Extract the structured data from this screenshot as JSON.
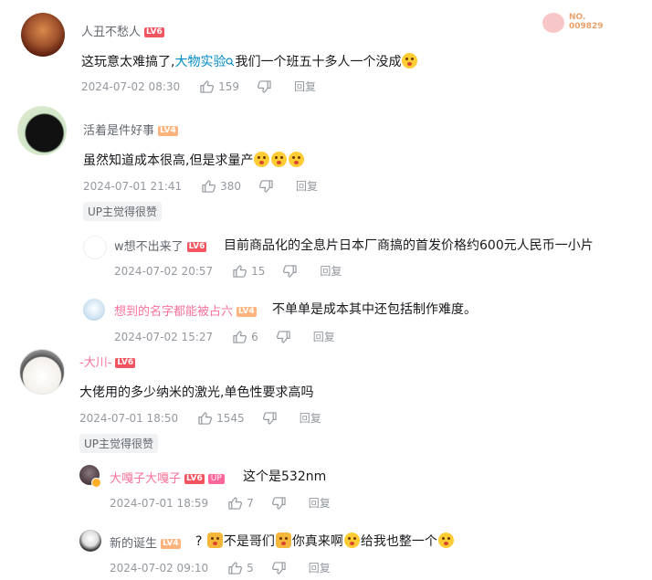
{
  "comments": [
    {
      "user": "人丑不愁人",
      "level": "LV6",
      "content_pre": "这玩意太难搞了,",
      "keyword": "大物实验",
      "content_post": "我们一个班五十多人一个没成",
      "time": "2024-07-02 08:30",
      "likes": "159",
      "reply_label": "回复",
      "badge": "NO.\n009829"
    },
    {
      "user": "活着是件好事",
      "level": "LV4",
      "content": "虽然知道成本很高,但是求量产",
      "time": "2024-07-01 21:41",
      "likes": "380",
      "reply_label": "回复",
      "up_tag": "UP主觉得很赞",
      "replies": [
        {
          "user": "w想不出来了",
          "level": "LV6",
          "content": "目前商品化的全息片日本厂商搞的首发价格约600元人民币一小片",
          "time": "2024-07-02 20:57",
          "likes": "15",
          "reply_label": "回复"
        },
        {
          "user": "想到的名字都能被占六",
          "level": "LV4",
          "content": "不单单是成本其中还包括制作难度。",
          "time": "2024-07-02 15:27",
          "likes": "6",
          "reply_label": "回复"
        }
      ]
    },
    {
      "user": "-大川-",
      "level": "LV6",
      "content": "大佬用的多少纳米的激光,单色性要求高吗",
      "time": "2024-07-01 18:50",
      "likes": "1545",
      "reply_label": "回复",
      "up_tag": "UP主觉得很赞",
      "replies": [
        {
          "user": "大嘎子大嘎子",
          "level": "LV6",
          "up_badge": "UP",
          "content": "这个是532nm",
          "time": "2024-07-01 18:59",
          "likes": "7",
          "reply_label": "回复"
        },
        {
          "user": "新的诞生",
          "level": "LV4",
          "content_a": "?",
          "content_b": "不是哥们",
          "content_c": "你真来啊",
          "content_d": "给我也整一个",
          "time": "2024-07-02 09:10",
          "likes": "5",
          "reply_label": "回复"
        }
      ]
    }
  ]
}
